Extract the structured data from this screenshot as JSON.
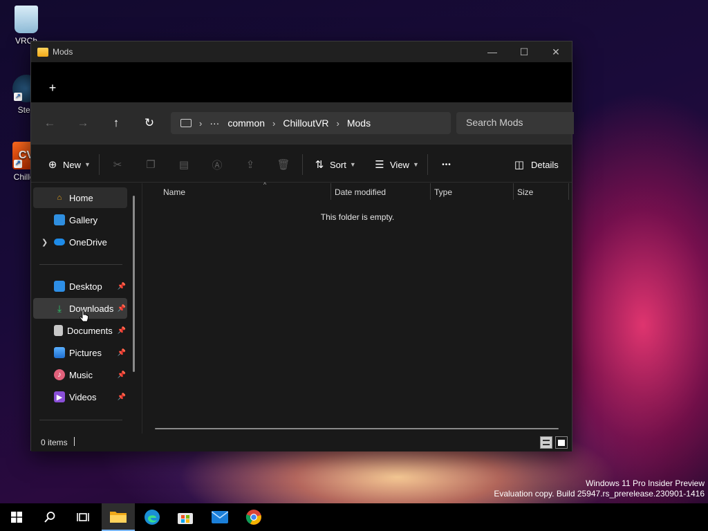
{
  "desktop": {
    "icons": [
      {
        "label": "VRCh"
      },
      {
        "label": "Stea"
      },
      {
        "label": "Chillou"
      }
    ],
    "cvr_icon_text": "CV"
  },
  "window": {
    "title": "Mods",
    "controls": {
      "minimize": "—",
      "maximize": "☐",
      "close": "✕"
    },
    "newtab_glyph": "+",
    "nav": {
      "back": "←",
      "forward": "→",
      "up": "↑",
      "refresh": "↻"
    },
    "breadcrumb": {
      "overflow": "···",
      "segments": [
        "common",
        "ChilloutVR",
        "Mods"
      ],
      "separator": "›"
    },
    "search_placeholder": "Search Mods",
    "toolbar": {
      "new_label": "New",
      "sort_label": "Sort",
      "view_label": "View",
      "more_glyph": "•••",
      "details_label": "Details"
    },
    "sidebar": {
      "top": [
        {
          "label": "Home"
        },
        {
          "label": "Gallery"
        },
        {
          "label": "OneDrive"
        }
      ],
      "pinned": [
        {
          "label": "Desktop"
        },
        {
          "label": "Downloads"
        },
        {
          "label": "Documents"
        },
        {
          "label": "Pictures"
        },
        {
          "label": "Music"
        },
        {
          "label": "Videos"
        }
      ]
    },
    "columns": [
      "Name",
      "Date modified",
      "Type",
      "Size"
    ],
    "empty_message": "This folder is empty.",
    "status": {
      "items": "0 items"
    }
  },
  "watermark": {
    "line1": "Windows 11 Pro Insider Preview",
    "line2": "Evaluation copy. Build 25947.rs_prerelease.230901-1416"
  },
  "colors": {
    "accent": "#7ab7ff",
    "window_bg": "#191919",
    "folder": "#f0a919"
  }
}
